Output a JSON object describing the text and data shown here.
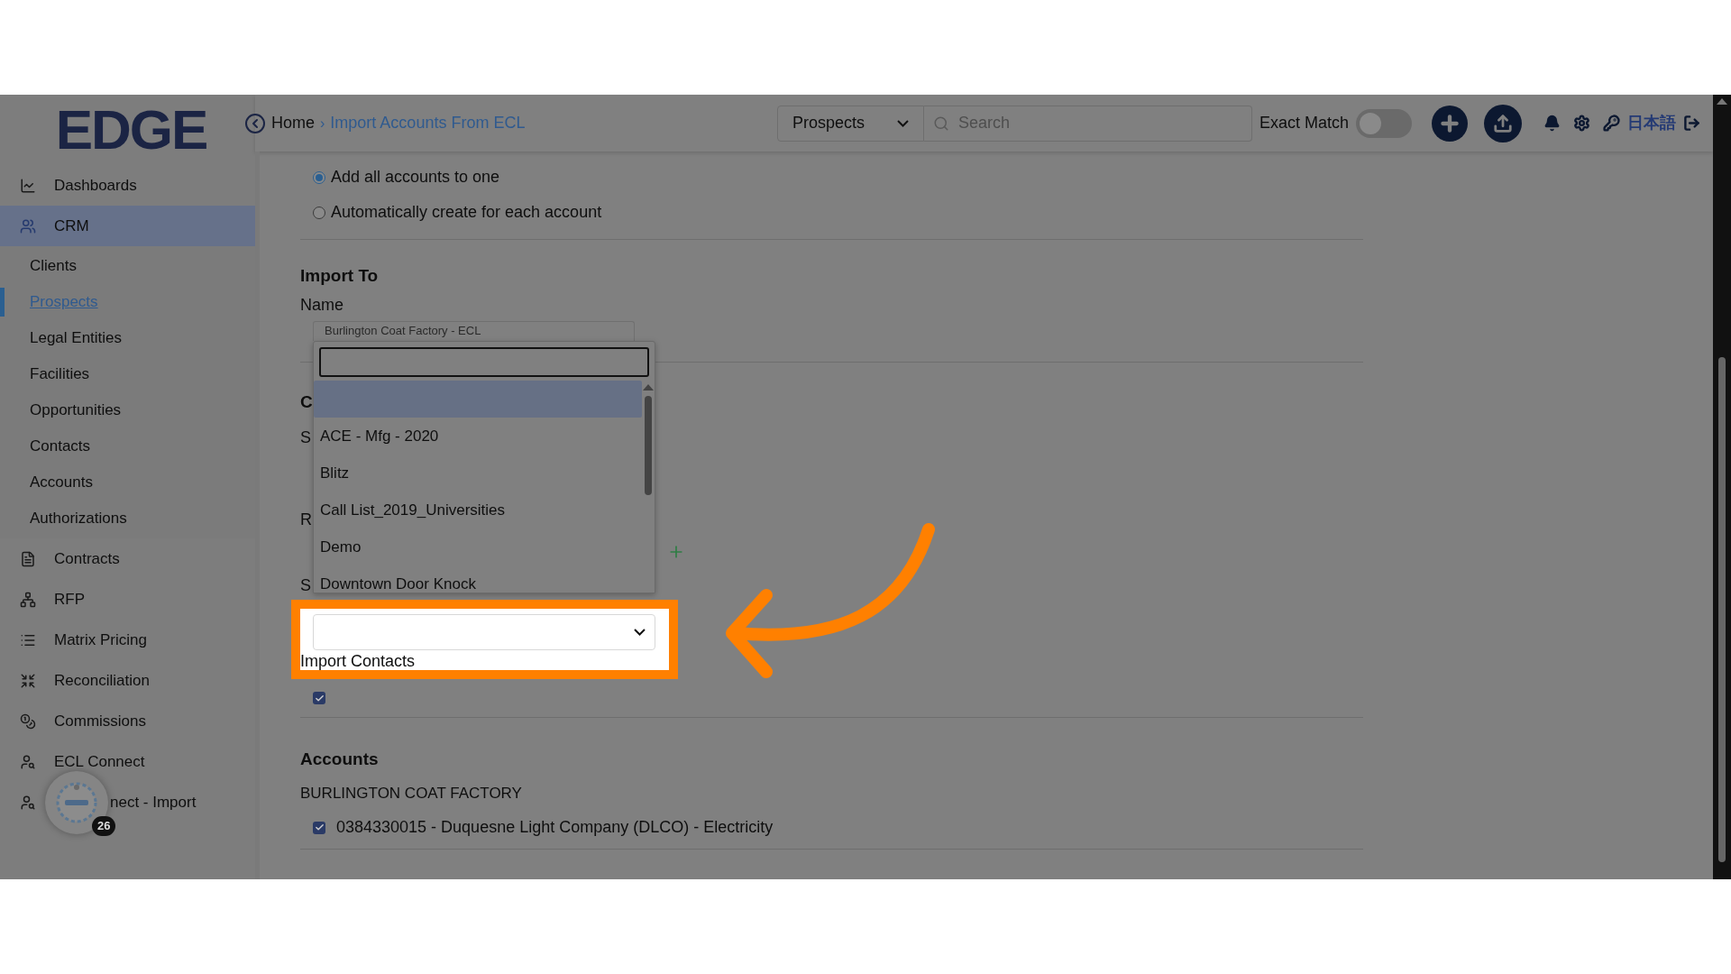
{
  "logo": "EDGE",
  "breadcrumb": {
    "home": "Home",
    "separator": "›",
    "current": "Import Accounts From ECL"
  },
  "top_bar": {
    "module_select": "Prospects",
    "search": {
      "placeholder": "Search"
    },
    "exact_match": {
      "label": "Exact Match",
      "on": false
    },
    "language": "日本語"
  },
  "sidebar": {
    "items": [
      {
        "label": "Dashboards",
        "selected": false
      },
      {
        "label": "CRM",
        "selected": true,
        "expanded": true,
        "children": [
          {
            "label": "Clients",
            "selected": false
          },
          {
            "label": "Prospects",
            "selected": true
          },
          {
            "label": "Legal Entities",
            "selected": false
          },
          {
            "label": "Facilities",
            "selected": false
          },
          {
            "label": "Opportunities",
            "selected": false
          },
          {
            "label": "Contacts",
            "selected": false
          },
          {
            "label": "Accounts",
            "selected": false
          },
          {
            "label": "Authorizations",
            "selected": false
          }
        ]
      },
      {
        "label": "Contracts",
        "selected": false
      },
      {
        "label": "RFP",
        "selected": false
      },
      {
        "label": "Matrix Pricing",
        "selected": false
      },
      {
        "label": "Reconciliation",
        "selected": false
      },
      {
        "label": "Commissions",
        "selected": false
      },
      {
        "label": "ECL Connect",
        "selected": false
      },
      {
        "label": "nect - Import",
        "selected": false
      }
    ]
  },
  "help_widget": {
    "badge": "26"
  },
  "form": {
    "radios": [
      {
        "label": "Add all accounts to one",
        "selected": true
      },
      {
        "label": "Automatically create for each account",
        "selected": false
      }
    ],
    "import_to": {
      "title": "Import To",
      "name_label": "Name",
      "name_value": "Burlington Coat Factory - ECL"
    },
    "partial_labels": [
      "C",
      "S",
      "R",
      "S"
    ],
    "import_contacts": {
      "label": "Import Contacts",
      "checked": true
    },
    "accounts": {
      "title": "Accounts",
      "group": "BURLINGTON COAT FACTORY",
      "items": [
        {
          "label": "0384330015 - Duquesne Light Company (DLCO) - Electricity",
          "checked": true
        }
      ]
    }
  },
  "dropdown": {
    "options": [
      {
        "selected": true
      },
      {
        "label": "ACE - Mfg - 2020",
        "selected": false
      },
      {
        "label": "Blitz",
        "selected": false
      },
      {
        "label": "Call List_2019_Universities",
        "selected": false
      },
      {
        "label": "Demo",
        "selected": false
      },
      {
        "label": "Downtown Door Knock",
        "selected": false
      }
    ]
  }
}
